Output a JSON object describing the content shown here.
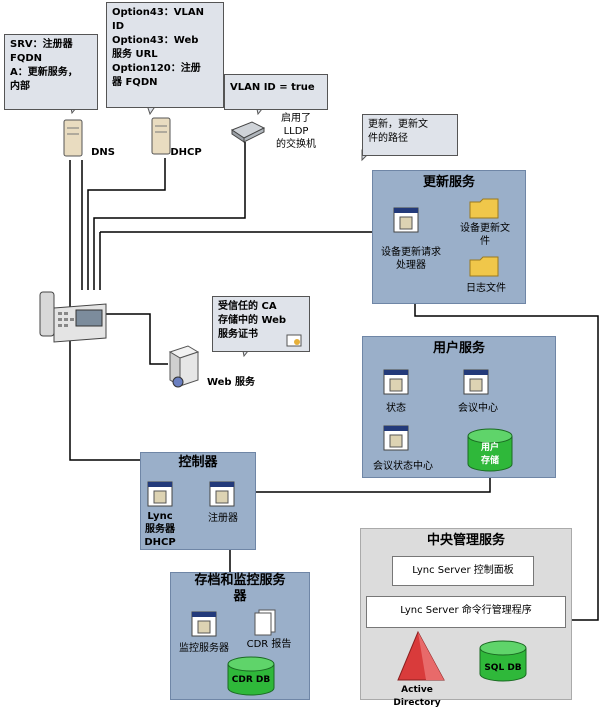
{
  "callouts": {
    "dns_records": "SRV：注册器\nFQDN\nA：更新服务，\n内部",
    "dhcp_options": "Option43：VLAN\nID\nOption43：Web\n服务 URL\nOption120：注册\n器 FQDN",
    "vlan": "VLAN ID = true",
    "update_paths": "更新，更新文\n件的路径",
    "web_cert": "受信任的 CA\n存储中的 Web\n服务证书"
  },
  "nodes": {
    "dns": "DNS",
    "dhcp": "DHCP",
    "lldp_switch": "启用了\nLLDP\n的交换机",
    "web_service": "Web 服务"
  },
  "update_service": {
    "title": "更新服务",
    "request_handler": "设备更新请求\n处理器",
    "device_update_files": "设备更新文\n件",
    "log_files": "日志文件"
  },
  "user_service": {
    "title": "用户服务",
    "presence": "状态",
    "conference_center": "会议中心",
    "conference_status": "会议状态中心",
    "user_store": "用户\n存储"
  },
  "director": {
    "title": "控制器",
    "lync_dhcp": "Lync\n服务器\nDHCP",
    "registrar": "注册器"
  },
  "archiving": {
    "title": "存档和监控服务\n器",
    "monitoring_server": "监控服务器",
    "cdr_report": "CDR 报告",
    "cdr_db": "CDR DB"
  },
  "central_mgmt": {
    "title": "中央管理服务",
    "control_panel": "Lync Server 控制面板",
    "shell": "Lync Server 命令行管理程序",
    "active_directory": "Active Directory",
    "sql_db": "SQL DB"
  },
  "colors": {
    "panel_blue": "#9aafc9",
    "callout_bg": "#dfe3ea",
    "db_green": "#2fb83a",
    "ad_red": "#d93b3b",
    "folder_yellow": "#f0c74a"
  }
}
